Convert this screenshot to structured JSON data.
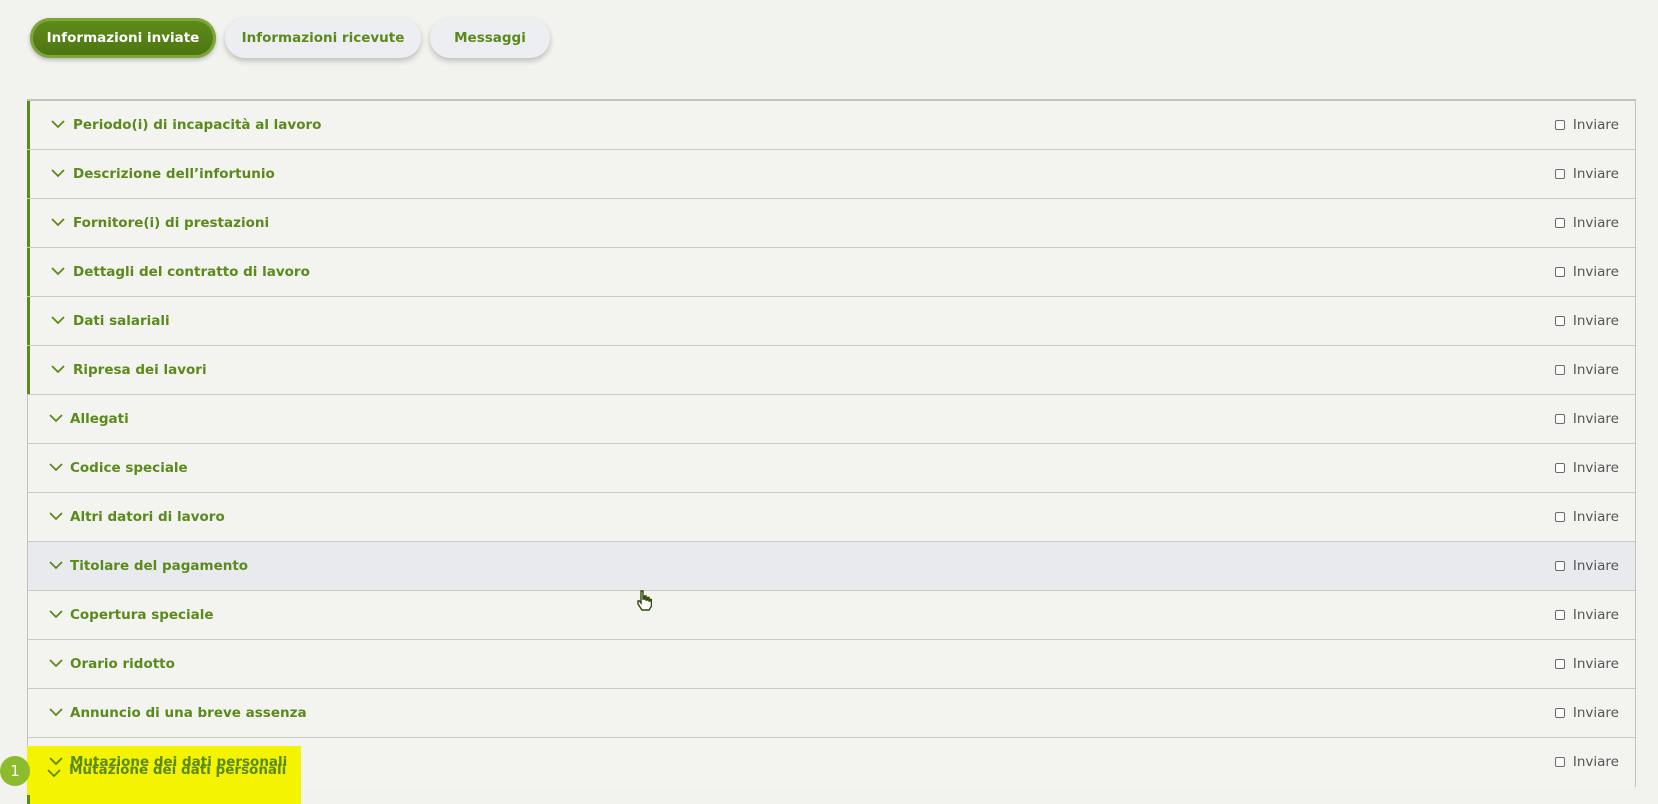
{
  "tabs": [
    {
      "label": "Informazioni inviate",
      "active": true
    },
    {
      "label": "Informazioni ricevute",
      "active": false
    },
    {
      "label": "Messaggi",
      "active": false
    }
  ],
  "send_label": "Inviare",
  "sections": [
    {
      "title": "Periodo(i) di incapacità al lavoro"
    },
    {
      "title": "Descrizione dell’infortunio"
    },
    {
      "title": "Fornitore(i) di prestazioni"
    },
    {
      "title": "Dettagli del contratto di lavoro"
    },
    {
      "title": "Dati salariali"
    },
    {
      "title": "Ripresa dei lavori"
    },
    {
      "title": "Allegati"
    },
    {
      "title": "Codice speciale"
    },
    {
      "title": "Altri datori di lavoro"
    },
    {
      "title": "Titolare del pagamento"
    },
    {
      "title": "Copertura speciale"
    },
    {
      "title": "Orario ridotto"
    },
    {
      "title": "Annuncio di una breve assenza"
    },
    {
      "title": "Mutazione dei dati personali"
    }
  ],
  "step_badge": "1",
  "colors": {
    "accent": "#5b8a1c",
    "highlight": "#f4f400",
    "badge": "#8dbb2e"
  },
  "icons": {
    "expand": "chevron-down-icon",
    "cursor": "hand-pointer-icon"
  }
}
